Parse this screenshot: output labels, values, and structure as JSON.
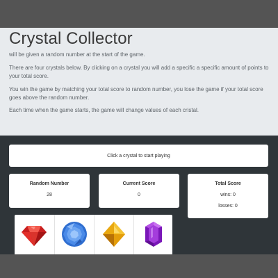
{
  "game": {
    "title": "Crystal Collector",
    "paragraphs": [
      "will be given a random number at the start of the game.",
      "There are four crystals below. By clicking on a crystal you will add a specific a specific amount of points to your total score.",
      "You win the game by matching your total score to random number, you lose the game if your total score goes above the random number.",
      "Each time when the game starts, the game will change values of each cristal."
    ],
    "play_prompt": "Click a crystal to start playing"
  },
  "scoreboard": {
    "random_label": "Random Number",
    "random_value": "28",
    "current_label": "Current Score",
    "current_value": "0",
    "total_label": "Total Score",
    "wins_text": "wins: 0",
    "losses_text": "losses: 0"
  },
  "crystals": [
    {
      "icon": "red-crystal-icon",
      "color": "#e0302b"
    },
    {
      "icon": "blue-crystal-icon",
      "color": "#3f7fe0"
    },
    {
      "icon": "yellow-crystal-icon",
      "color": "#e8a90f"
    },
    {
      "icon": "purple-crystal-icon",
      "color": "#8e22c9"
    }
  ]
}
